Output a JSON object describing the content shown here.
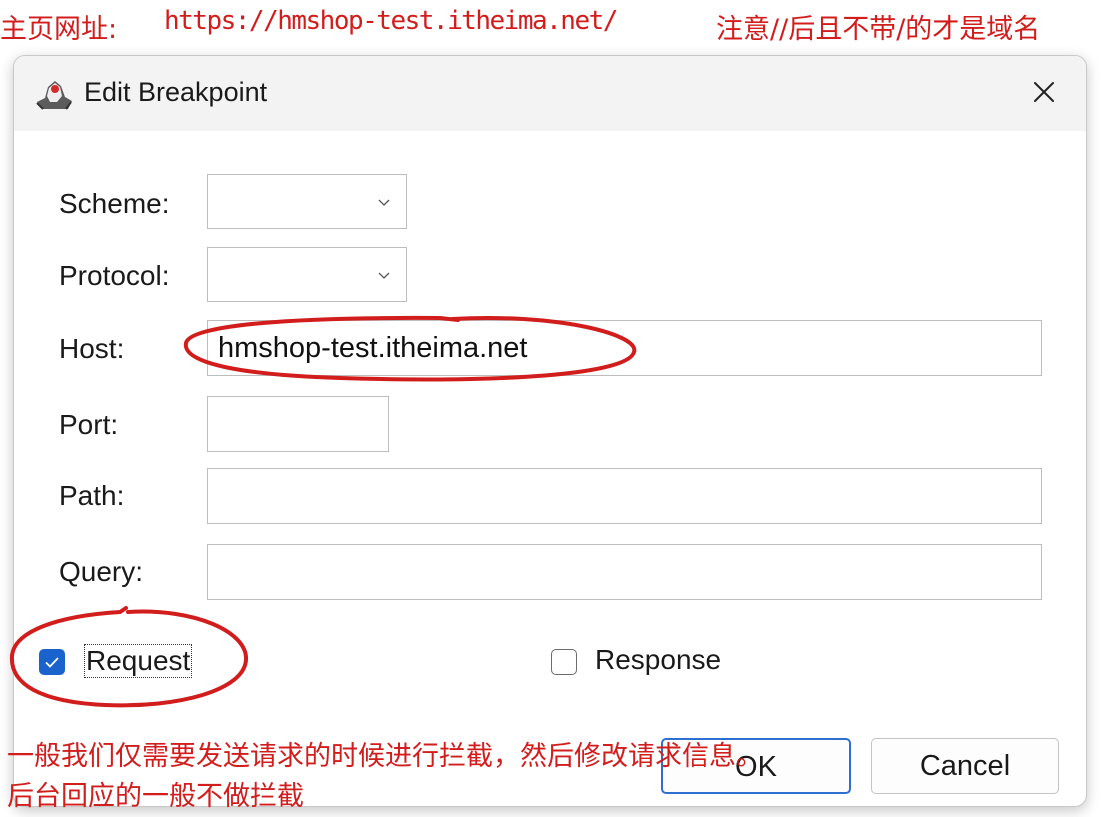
{
  "top_note": {
    "label": "主页网址:",
    "url": "https://hmshop-test.itheima.net/",
    "hint": "注意//后且不带/的才是域名"
  },
  "dialog": {
    "title": "Edit Breakpoint",
    "fields": {
      "scheme": {
        "label": "Scheme:",
        "value": ""
      },
      "protocol": {
        "label": "Protocol:",
        "value": ""
      },
      "host": {
        "label": "Host:",
        "value": "hmshop-test.itheima.net"
      },
      "port": {
        "label": "Port:",
        "value": ""
      },
      "path": {
        "label": "Path:",
        "value": ""
      },
      "query": {
        "label": "Query:",
        "value": ""
      }
    },
    "request": {
      "label": "Request",
      "checked": true
    },
    "response": {
      "label": "Response",
      "checked": false
    },
    "buttons": {
      "ok": "OK",
      "cancel": "Cancel"
    }
  },
  "bottom_note": {
    "line1": "一般我们仅需要发送请求的时候进行拦截，然后修改请求信息。",
    "line2": "后台回应的一般不做拦截"
  },
  "colors": {
    "annotation": "#d21d1d",
    "checkbox_checked": "#1a63cc",
    "default_button_border": "#2f6fd0"
  },
  "icons": {
    "app": "java-duke-icon",
    "close": "close-icon",
    "dropdown": "chevron-down-icon",
    "check": "check-icon"
  }
}
